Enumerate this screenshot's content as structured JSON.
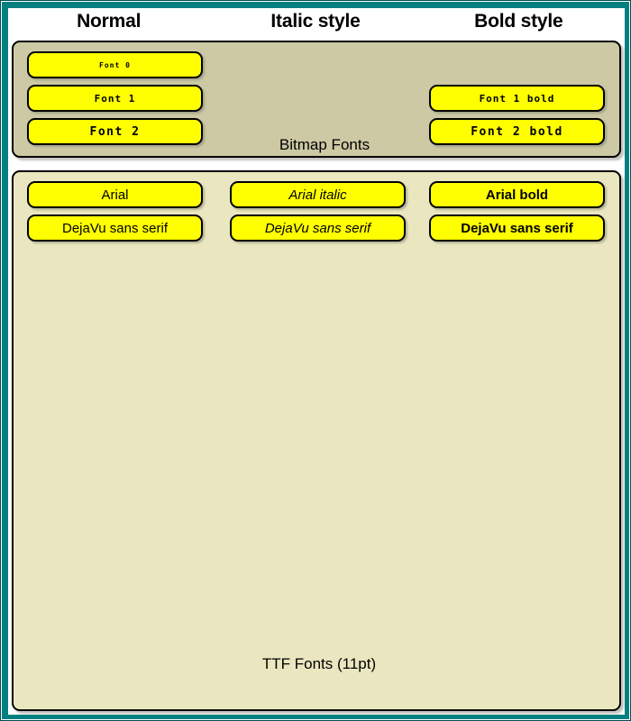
{
  "window": {
    "frame_color": "#008080",
    "frame_outline_color": "#004c4c",
    "background": "#ffffff"
  },
  "header": {
    "columns": [
      {
        "label": "Normal"
      },
      {
        "label": "Italic style"
      },
      {
        "label": "Bold style"
      }
    ]
  },
  "panels": {
    "bitmap": {
      "caption": "Bitmap Fonts",
      "background": "#ccc9a4",
      "border_color": "#000000",
      "columns": {
        "normal": [
          {
            "label": "Font 0",
            "size_class": "bm-0"
          },
          {
            "label": "Font 1",
            "size_class": "bm-1"
          },
          {
            "label": "Font 2",
            "size_class": "bm-2"
          }
        ],
        "italic": [],
        "bold": [
          {
            "label": "Font 1 bold",
            "size_class": "bm-1"
          },
          {
            "label": "Font 2 bold",
            "size_class": "bm-2"
          }
        ]
      }
    },
    "ttf": {
      "caption": "TTF Fonts (11pt)",
      "background": "#eae7c0",
      "border_color": "#000000",
      "columns": {
        "normal": [
          {
            "label": "Arial"
          },
          {
            "label": "DejaVu sans serif"
          }
        ],
        "italic": [
          {
            "label": "Arial italic"
          },
          {
            "label": "DejaVu sans serif"
          }
        ],
        "bold": [
          {
            "label": "Arial bold"
          },
          {
            "label": "DejaVu sans serif"
          }
        ]
      }
    }
  },
  "button_style": {
    "fill": "#ffff00",
    "text_color": "#000000"
  }
}
